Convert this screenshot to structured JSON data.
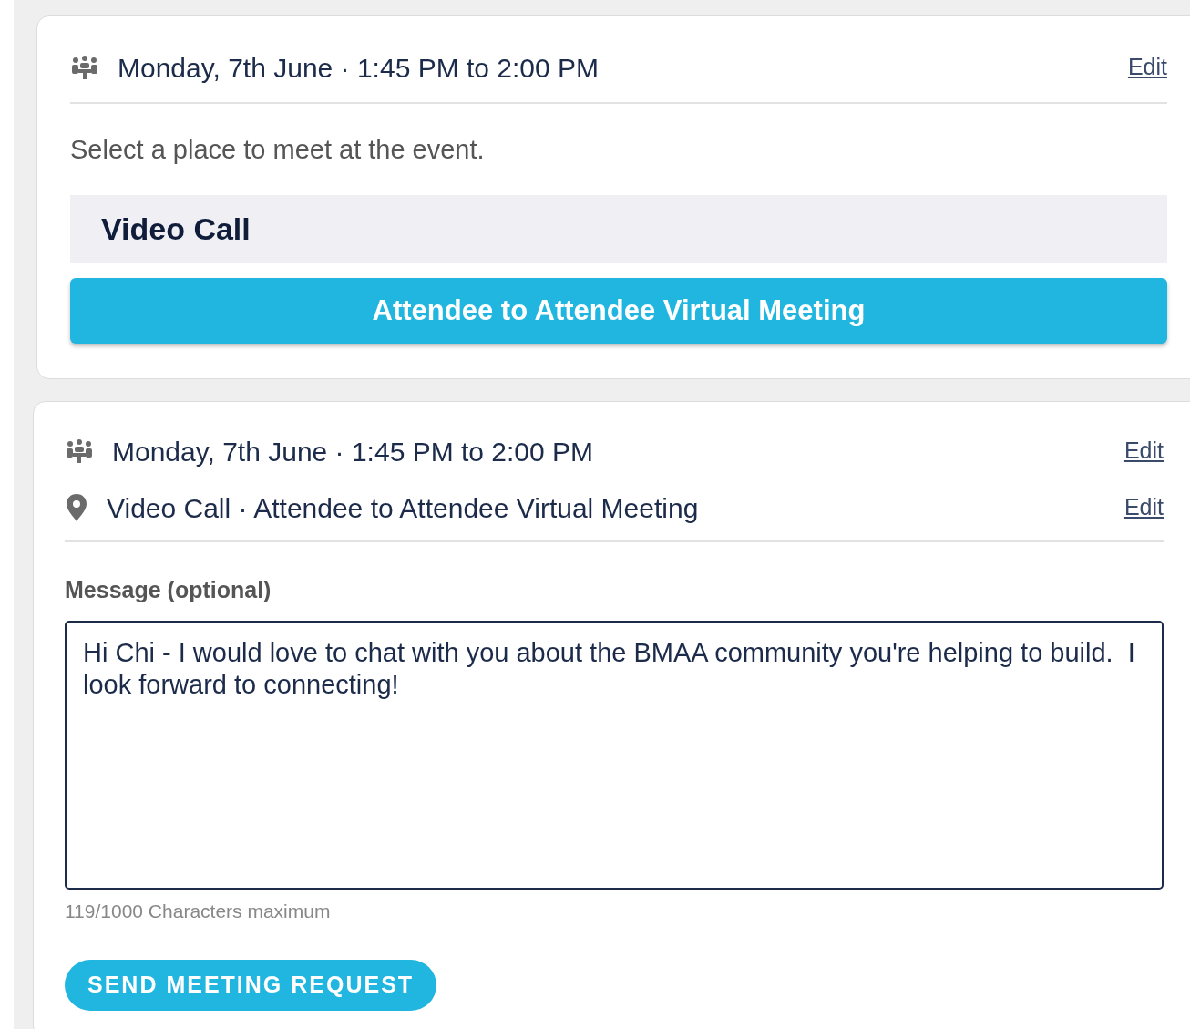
{
  "time_card": {
    "datetime": "Monday, 7th June · 1:45 PM to 2:00 PM",
    "edit_link": "Edit",
    "prompt": "Select a place to meet at the event.",
    "place_group": "Video Call",
    "options": [
      {
        "label": "Attendee to Attendee Virtual Meeting",
        "selected": true
      }
    ]
  },
  "request_card": {
    "summary": [
      {
        "kind": "time",
        "text": "Monday, 7th June · 1:45 PM to 2:00 PM",
        "edit_link": "Edit"
      },
      {
        "kind": "place",
        "text": "Video Call · Attendee to Attendee Virtual Meeting",
        "edit_link": "Edit"
      }
    ],
    "message": {
      "label": "Message (optional)",
      "value": "Hi Chi - I would love to chat with you about the BMAA community you're helping to build.  I look forward to connecting!",
      "counter": "119/1000 Characters maximum"
    },
    "submit_button": "SEND MEETING REQUEST"
  }
}
